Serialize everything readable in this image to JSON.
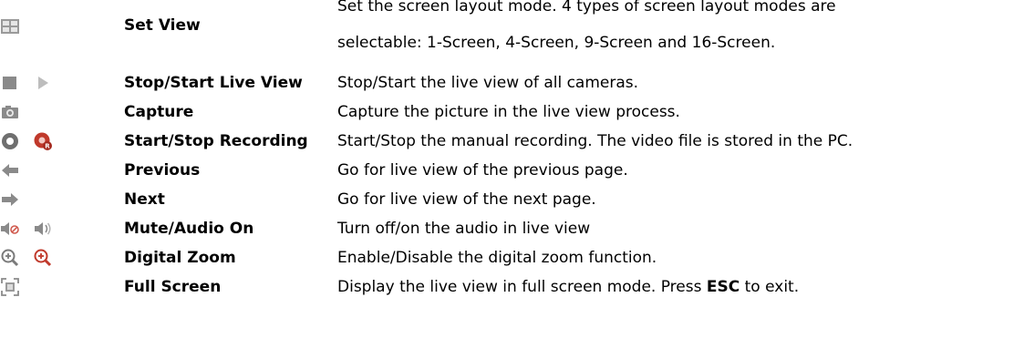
{
  "rows": [
    {
      "name": "Set View",
      "icons": [
        "grid-layout-icon"
      ],
      "desc_lines": [
        "Set the screen layout mode. 4 types of screen layout modes are",
        "selectable: 1-Screen, 4-Screen, 9-Screen and 16-Screen."
      ]
    },
    {
      "name": "Stop/Start Live View",
      "icons": [
        "stop-icon",
        "play-icon"
      ],
      "desc": "Stop/Start the live view of all cameras."
    },
    {
      "name": "Capture",
      "icons": [
        "camera-icon"
      ],
      "desc": "Capture the picture in the live view process."
    },
    {
      "name": "Start/Stop Recording",
      "icons": [
        "record-start-icon",
        "record-stop-icon"
      ],
      "desc": "Start/Stop the manual recording. The video file is stored in the PC."
    },
    {
      "name": "Previous",
      "icons": [
        "arrow-left-icon"
      ],
      "desc": "Go for live view of the previous page."
    },
    {
      "name": "Next",
      "icons": [
        "arrow-right-icon"
      ],
      "desc": "Go for live view of the next page."
    },
    {
      "name": "Mute/Audio On",
      "icons": [
        "mute-icon",
        "audio-on-icon"
      ],
      "desc": "Turn off/on the audio in live view"
    },
    {
      "name": "Digital Zoom",
      "icons": [
        "zoom-enable-icon",
        "zoom-disable-icon"
      ],
      "desc": "Enable/Disable the digital zoom function."
    },
    {
      "name": "Full Screen",
      "icons": [
        "fullscreen-icon"
      ],
      "desc_pre": "Display the live view in full screen mode. Press ",
      "desc_bold": "ESC",
      "desc_post": " to exit."
    }
  ],
  "colors": {
    "icon_gray": "#8a8a8a",
    "icon_light": "#c4c4c4",
    "record_red": "#c0392b",
    "zoom_red": "#c0392b"
  }
}
